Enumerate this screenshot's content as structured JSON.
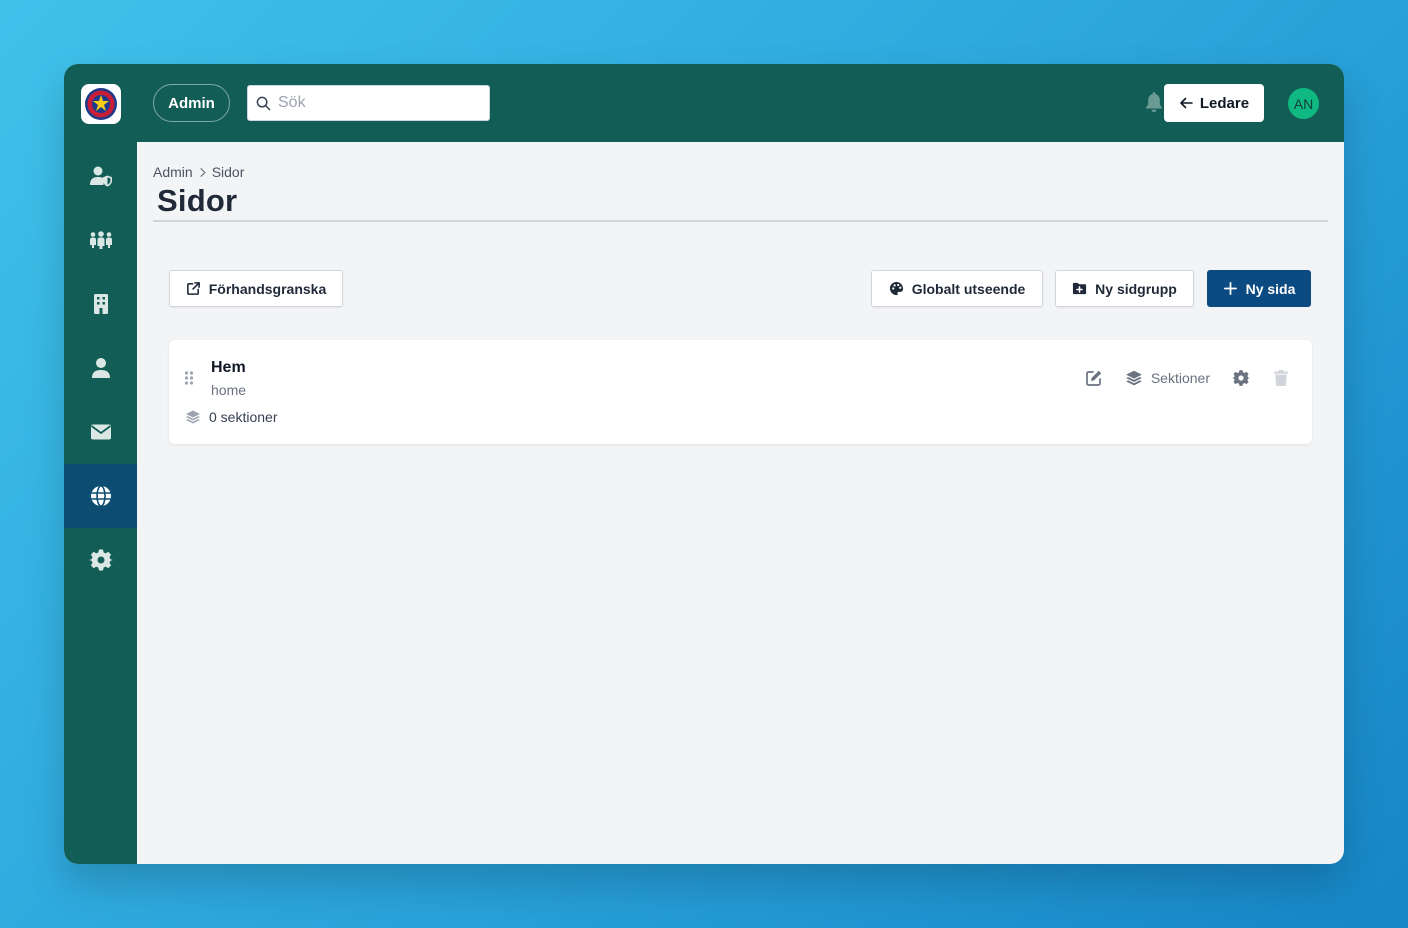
{
  "topbar": {
    "admin_label": "Admin",
    "search_placeholder": "Sök",
    "ledare_label": "Ledare",
    "avatar_initials": "AN"
  },
  "sidebar": {
    "items": [
      {
        "icon": "user-shield-icon"
      },
      {
        "icon": "users-group-icon"
      },
      {
        "icon": "building-icon"
      },
      {
        "icon": "user-icon"
      },
      {
        "icon": "envelope-icon"
      },
      {
        "icon": "globe-icon",
        "active": true
      },
      {
        "icon": "gear-icon"
      }
    ]
  },
  "breadcrumb": [
    "Admin",
    "Sidor"
  ],
  "page": {
    "title": "Sidor"
  },
  "toolbar": {
    "preview_label": "Förhandsgranska",
    "global_appearance_label": "Globalt utseende",
    "new_page_group_label": "Ny sidgrupp",
    "new_page_label": "Ny sida"
  },
  "pages": [
    {
      "title": "Hem",
      "slug": "home",
      "sections_count": "0 sektioner",
      "sections_label": "Sektioner"
    }
  ],
  "colors": {
    "sidebar": "#125e56",
    "active_nav": "#0d4d72",
    "primary_button": "#0c4a82",
    "avatar": "#10b981"
  }
}
